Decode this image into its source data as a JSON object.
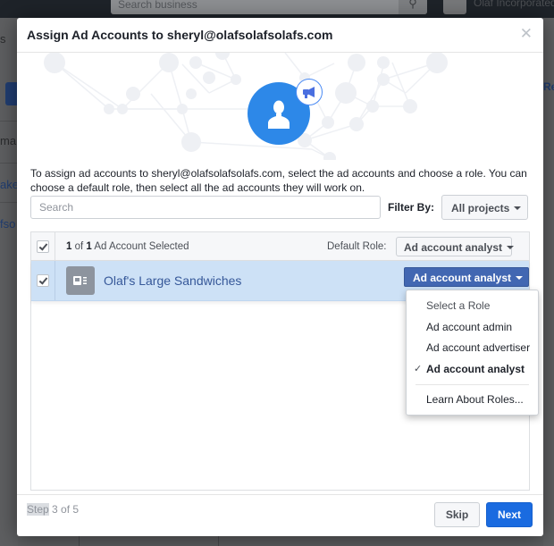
{
  "background": {
    "search_placeholder": "Search business",
    "search_icon": "search-icon",
    "business_name": "Olaf Incorporated",
    "left_tab": "s",
    "left_rows": [
      "ma",
      "ake",
      "fso"
    ],
    "right_link": "Re"
  },
  "dialog": {
    "title": "Assign Ad Accounts to sheryl@olafsolafsolafs.com",
    "close_icon": "close-icon",
    "hero_icon": "person-icon",
    "hero_badge_icon": "megaphone-icon",
    "description": "To assign ad accounts to sheryl@olafsolafsolafs.com, select the ad accounts and choose a role. You can choose a default role, then select all the ad accounts they will work on.",
    "search": {
      "placeholder": "Search",
      "value": ""
    },
    "filter": {
      "label": "Filter By:",
      "value": "All projects"
    },
    "table": {
      "header": {
        "select_all_checked": true,
        "selected_num": "1",
        "of": "of",
        "total_num": "1",
        "selected_suffix": "Ad Account Selected",
        "default_role_label": "Default Role:",
        "default_role_value": "Ad account analyst"
      },
      "rows": [
        {
          "checked": true,
          "name": "Olaf's Large Sandwiches",
          "role": "Ad account analyst"
        }
      ]
    },
    "role_menu": {
      "items": [
        {
          "label": "Select a Role",
          "selected": false
        },
        {
          "label": "Ad account admin",
          "selected": false
        },
        {
          "label": "Ad account advertiser",
          "selected": false
        },
        {
          "label": "Ad account analyst",
          "selected": true
        }
      ],
      "check_glyph": "✓",
      "footer_link": "Learn About Roles..."
    },
    "footer": {
      "step_word": "Step",
      "step_rest": "3 of 5",
      "skip_label": "Skip",
      "next_label": "Next"
    }
  },
  "colors": {
    "primary": "#4267b2",
    "next_button": "#1a6be0",
    "selected_row": "#cde1f6",
    "link": "#365899",
    "avatar": "#2d88e8"
  }
}
